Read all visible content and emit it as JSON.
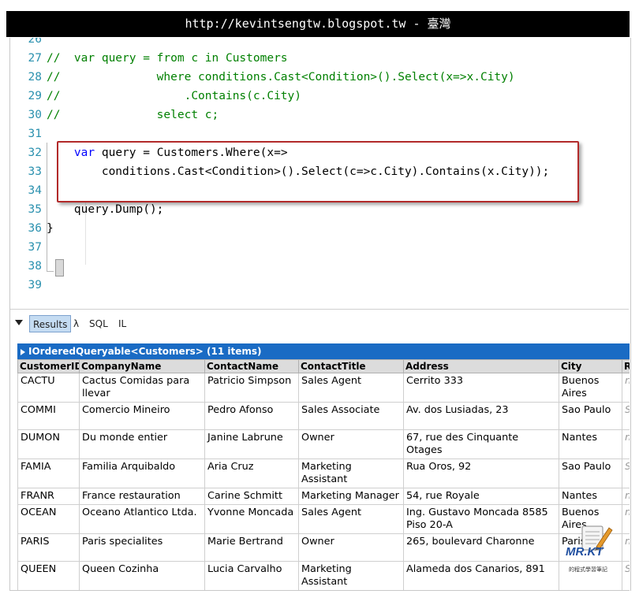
{
  "banner": {
    "text": "http://kevintsengtw.blogspot.tw - 臺灣"
  },
  "editor": {
    "line_numbers": [
      "26",
      "27",
      "28",
      "29",
      "30",
      "31",
      "32",
      "33",
      "34",
      "35",
      "36",
      "37",
      "38",
      "39"
    ],
    "lines": [
      "",
      "//  var query = from c in Customers",
      "//              where conditions.Cast<Condition>().Select(x=>x.City)",
      "//                  .Contains(c.City)",
      "//              select c;",
      "",
      "    var query = Customers.Where(x=>",
      "        conditions.Cast<Condition>().Select(c=>c.City).Contains(x.City));",
      "",
      "    query.Dump();",
      "}",
      "",
      "",
      ""
    ],
    "keyword": "var"
  },
  "results_tabs": [
    {
      "label": "Results"
    },
    {
      "label": "λ"
    },
    {
      "label": "SQL"
    },
    {
      "label": "IL"
    }
  ],
  "results": {
    "header": "IOrderedQueryable<Customers> (11 items)",
    "columns": [
      "CustomerID",
      "CompanyName",
      "ContactName",
      "ContactTitle",
      "Address",
      "City",
      "R"
    ],
    "rows": [
      [
        "CACTU",
        "Cactus Comidas para llevar",
        "Patricio Simpson",
        "Sales Agent",
        "Cerrito 333",
        "Buenos Aires",
        "n"
      ],
      [
        "COMMI",
        "Comercio Mineiro",
        "Pedro Afonso",
        "Sales Associate",
        "Av. dos Lusiadas, 23",
        "Sao Paulo",
        "S"
      ],
      [
        "DUMON",
        "Du monde entier",
        "Janine Labrune",
        "Owner",
        "67, rue des Cinquante Otages",
        "Nantes",
        "n"
      ],
      [
        "FAMIA",
        "Familia Arquibaldo",
        "Aria Cruz",
        "Marketing Assistant",
        "Rua Oros, 92",
        "Sao Paulo",
        "S"
      ],
      [
        "FRANR",
        "France restauration",
        "Carine Schmitt",
        "Marketing Manager",
        "54, rue Royale",
        "Nantes",
        "n"
      ],
      [
        "OCEAN",
        "Oceano Atlantico Ltda.",
        "Yvonne Moncada",
        "Sales Agent",
        "Ing. Gustavo Moncada 8585 Piso 20-A",
        "Buenos Aires",
        "n"
      ],
      [
        "PARIS",
        "Paris specialites",
        "Marie Bertrand",
        "Owner",
        "265, boulevard Charonne",
        "Paris",
        "n"
      ],
      [
        "QUEEN",
        "Queen Cozinha",
        "Lucia Carvalho",
        "Marketing Assistant",
        "Alameda dos Canarios, 891",
        "",
        "S"
      ]
    ]
  },
  "watermark": {
    "title": "MR.KT",
    "subtitle": "的程式學習筆記"
  }
}
